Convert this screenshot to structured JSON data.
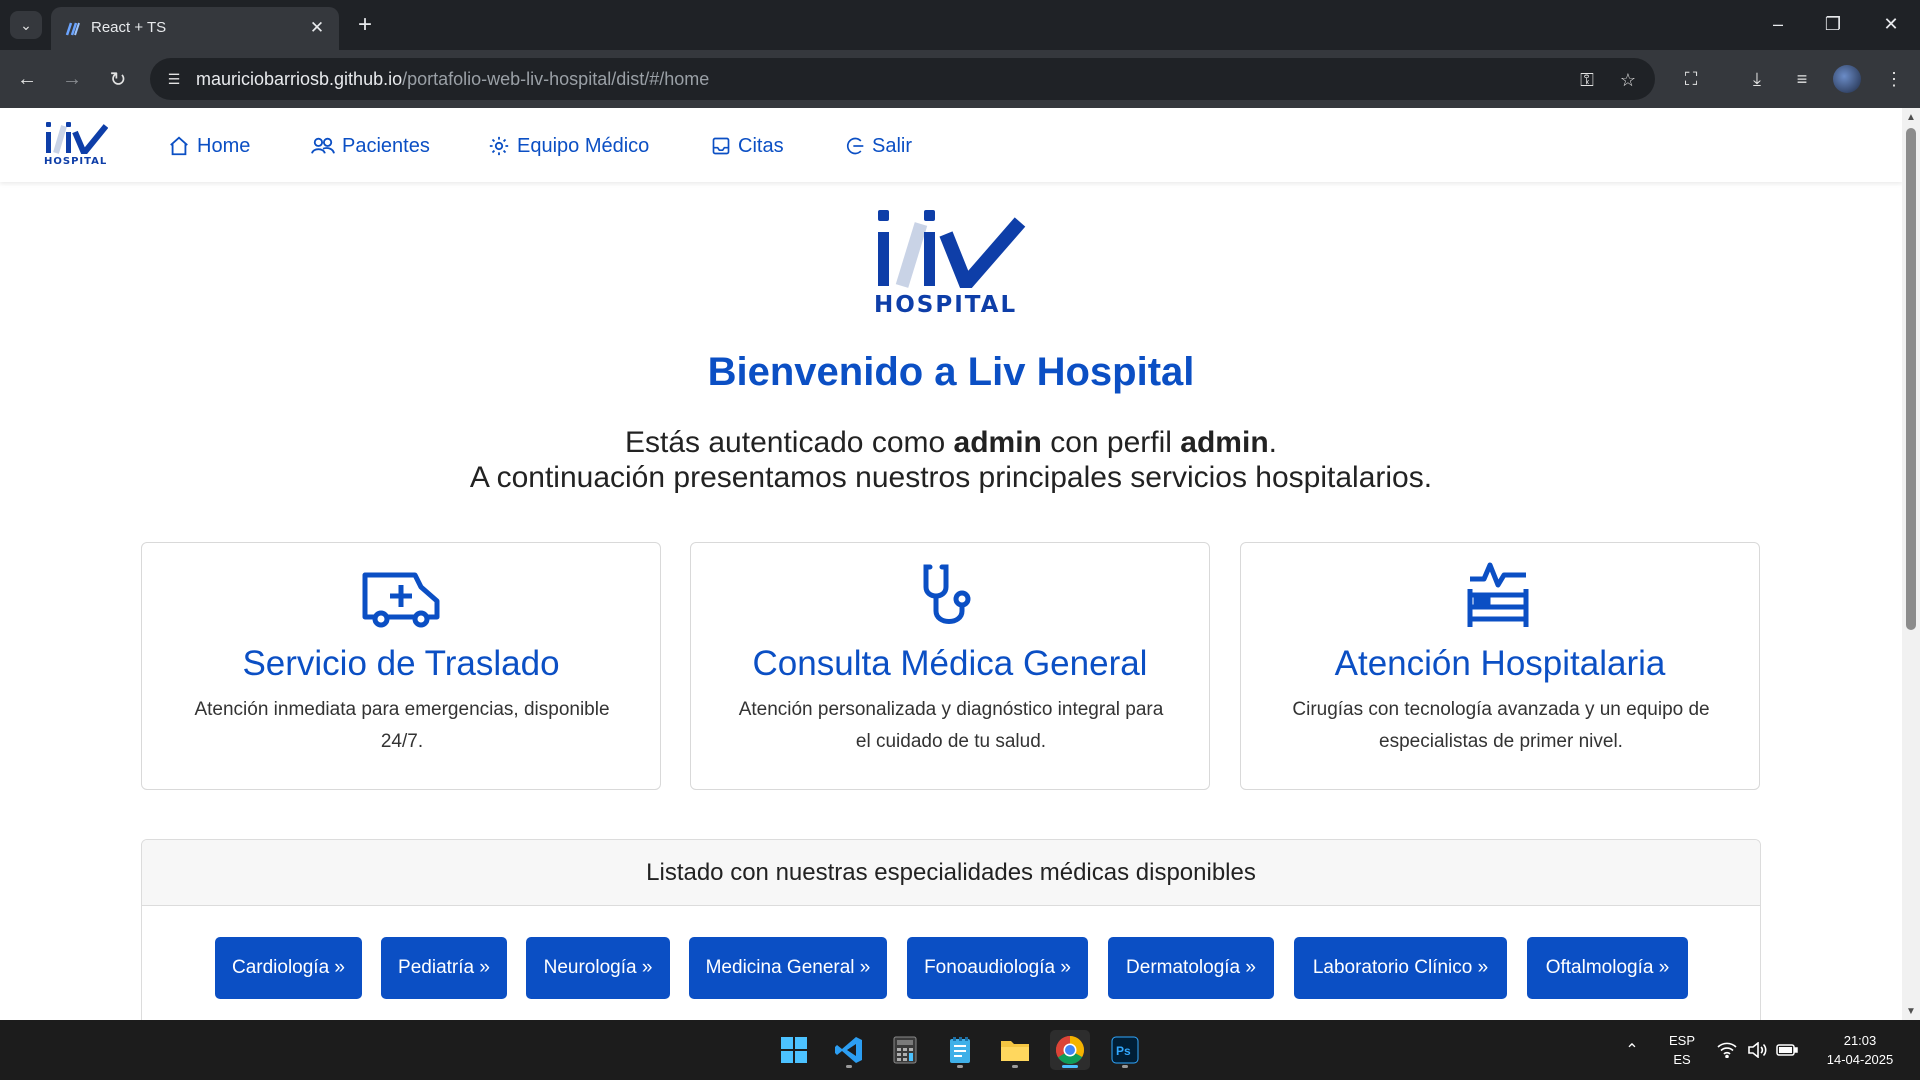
{
  "browser": {
    "tab_title": "React + TS",
    "url_host": "mauriciobarriosb.github.io",
    "url_path": "/portafolio-web-liv-hospital/dist/#/home"
  },
  "navbar": {
    "logo_sub": "HOSPITAL",
    "links": [
      {
        "label": "Home",
        "icon": "home-icon"
      },
      {
        "label": "Pacientes",
        "icon": "users-icon"
      },
      {
        "label": "Equipo Médico",
        "icon": "gear-icon"
      },
      {
        "label": "Citas",
        "icon": "inbox-icon"
      },
      {
        "label": "Salir",
        "icon": "logout-icon"
      }
    ]
  },
  "hero": {
    "logo_sub": "HOSPITAL",
    "welcome": "Bienvenido a Liv Hospital",
    "auth_prefix": "Estás autenticado como ",
    "auth_user": "admin",
    "auth_middle": " con perfil ",
    "auth_profile": "admin",
    "auth_suffix": ".",
    "intro": "A continuación presentamos nuestros principales servicios hospitalarios."
  },
  "services": [
    {
      "icon": "ambulance-icon",
      "title": "Servicio de Traslado",
      "description": "Atención inmediata para emergencias, disponible 24/7."
    },
    {
      "icon": "stethoscope-icon",
      "title": "Consulta Médica General",
      "description": "Atención personalizada y diagnóstico integral para el cuidado de tu salud."
    },
    {
      "icon": "hospital-bed-icon",
      "title": "Atención Hospitalaria",
      "description": "Cirugías con tecnología avanzada y un equipo de especialistas de primer nivel."
    }
  ],
  "specialties": {
    "header": "Listado con nuestras especialidades médicas disponibles",
    "items": [
      "Cardiología »",
      "Pediatría »",
      "Neurología »",
      "Medicina General »",
      "Fonoaudiología »",
      "Dermatología »",
      "Laboratorio Clínico »",
      "Oftalmología »"
    ]
  },
  "taskbar": {
    "lang_top": "ESP",
    "lang_bottom": "ES",
    "time": "21:03",
    "date": "14-04-2025"
  },
  "colors": {
    "brand_blue": "#0b4fc4",
    "logo_navy": "#0e3ea8",
    "button_blue": "#0b4fc4"
  }
}
